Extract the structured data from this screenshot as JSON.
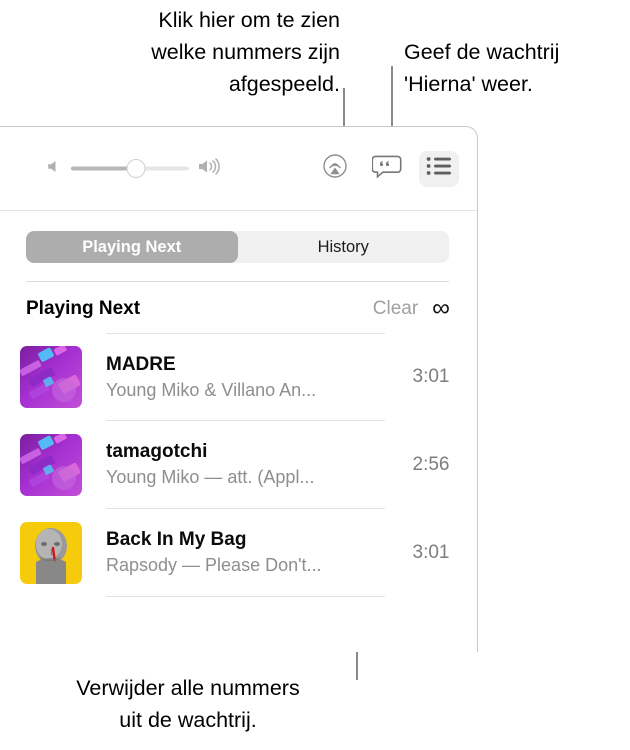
{
  "callouts": {
    "top_left": "Klik hier om te zien\nwelke nummers zijn\nafgespeeld.",
    "top_right": "Geef de wachtrij\n'Hierna' weer.",
    "bottom": "Verwijder alle nummers\nuit de wachtrij."
  },
  "toolbar": {
    "volume_label": "Volume",
    "volume_level": 55,
    "speaker_low_icon": "speaker-low-icon",
    "speaker_high_icon": "speaker-high-icon",
    "airplay_icon": "airplay-icon",
    "lyrics_icon": "lyrics-icon",
    "queue_icon": "queue-list-icon"
  },
  "tabs": [
    {
      "label": "Playing Next",
      "selected": true
    },
    {
      "label": "History",
      "selected": false
    }
  ],
  "queue": {
    "title": "Playing Next",
    "clear_label": "Clear",
    "infinity_symbol": "∞",
    "tracks": [
      {
        "title": "MADRE",
        "subtitle": "Young Miko & Villano An...",
        "duration": "3:01",
        "art": "album-art-purple"
      },
      {
        "title": "tamagotchi",
        "subtitle": "Young Miko — att. (Appl...",
        "duration": "2:56",
        "art": "album-art-purple"
      },
      {
        "title": "Back In My Bag",
        "subtitle": "Rapsody — Please Don't...",
        "duration": "3:01",
        "art": "album-art-yellow"
      }
    ]
  },
  "colors": {
    "selected_tab_bg": "#adadad",
    "segmented_bg": "#f0f0f0",
    "clear_text": "#a0a0a0",
    "leader_line": "#8a8a8a",
    "album_purple": "#8b2fb0",
    "album_yellow": "#f5cb0c"
  }
}
